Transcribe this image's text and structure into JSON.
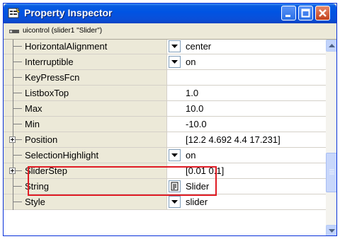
{
  "window": {
    "title": "Property Inspector",
    "object_label": "uicontrol (slider1 \"Slider\")"
  },
  "properties": [
    {
      "name": "HorizontalAlignment",
      "value": "center",
      "editor": "dropdown",
      "expandable": false
    },
    {
      "name": "Interruptible",
      "value": "on",
      "editor": "dropdown",
      "expandable": false
    },
    {
      "name": "KeyPressFcn",
      "value": "",
      "editor": "none",
      "expandable": false
    },
    {
      "name": "ListboxTop",
      "value": "1.0",
      "editor": "none",
      "expandable": false
    },
    {
      "name": "Max",
      "value": "10.0",
      "editor": "none",
      "expandable": false
    },
    {
      "name": "Min",
      "value": "-10.0",
      "editor": "none",
      "expandable": false
    },
    {
      "name": "Position",
      "value": "[12.2 4.692 4.4 17.231]",
      "editor": "none",
      "expandable": true
    },
    {
      "name": "SelectionHighlight",
      "value": "on",
      "editor": "dropdown",
      "expandable": false
    },
    {
      "name": "SliderStep",
      "value": "[0.01 0.1]",
      "editor": "none",
      "expandable": true
    },
    {
      "name": "String",
      "value": "Slider",
      "editor": "text-editor",
      "expandable": false
    },
    {
      "name": "Style",
      "value": "slider",
      "editor": "dropdown",
      "expandable": false
    }
  ],
  "colors": {
    "highlight_box": "#e01b24",
    "titlebar": "#0054e3"
  }
}
